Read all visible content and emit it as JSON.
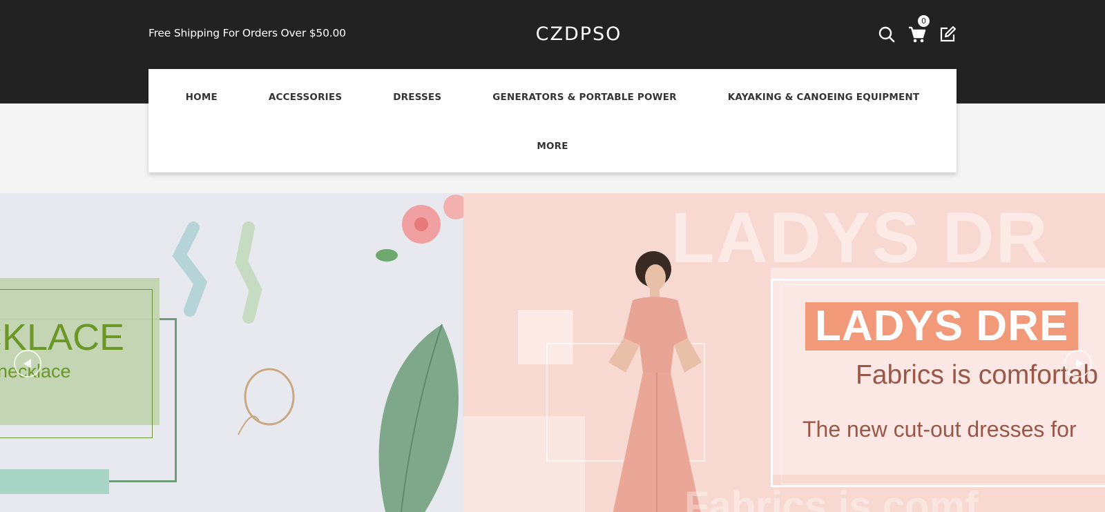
{
  "header": {
    "shipping_text": "Free Shipping For Orders Over $50.00",
    "logo_text": "CZDPSO",
    "cart_count": "0",
    "icons": [
      "search-icon",
      "cart-icon",
      "edit-icon"
    ]
  },
  "nav": {
    "items": [
      {
        "label": "HOME"
      },
      {
        "label": "ACCESSORIES"
      },
      {
        "label": "DRESSES"
      },
      {
        "label": "GENERATORS & PORTABLE POWER"
      },
      {
        "label": "KAYAKING & CANOEING EQUIPMENT"
      }
    ],
    "more_label": "MORE"
  },
  "banner": {
    "left": {
      "title": "CKLACE",
      "subtitle": "necklace"
    },
    "right": {
      "background_word": "LADYS DR",
      "title": "LADYS DRE",
      "subtitle": "Fabrics is comfortab",
      "tagline": "The new cut-out dresses for",
      "bottom_word": "Fabrics is comf"
    }
  },
  "colors": {
    "topbar": "#222222",
    "accent_green": "#6b9628",
    "accent_salmon": "#f2997a",
    "text_brown": "#9a5748"
  }
}
